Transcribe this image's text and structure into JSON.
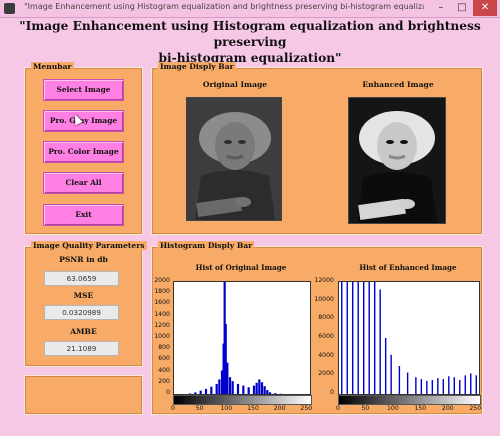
{
  "window": {
    "title": "\"Image Enhancement using Histogram equalization and brightness preserving bi-histogram equalization\"",
    "minimize": "–",
    "maximize": "□",
    "close": "✕",
    "icon": "matlab-figure-icon"
  },
  "header": {
    "line1": "\"Image Enhancement using Histogram equalization and brightness preserving",
    "line2": "bi-histogram equalization\""
  },
  "menubar": {
    "title": "Menubar",
    "buttons": [
      "Select Image",
      "Pro. Gray Image",
      "Pro. Color Image",
      "Clear All",
      "Exit"
    ]
  },
  "quality": {
    "title": "Image Quality Parameters",
    "psnr_label": "PSNR in db",
    "psnr_value": "63.0659",
    "mse_label": "MSE",
    "mse_value": "0.0320989",
    "ambe_label": "AMBE",
    "ambe_value": "21.1089"
  },
  "image_bar": {
    "title": "Image Disply Bar",
    "original_label": "Original Image",
    "enhanced_label": "Enhanced Image"
  },
  "hist_bar": {
    "title": "Histogram Disply Bar",
    "original_title": "Hist of Original Image",
    "enhanced_title": "Hist of Enhanced Image",
    "original_yticks": [
      "2000",
      "1800",
      "1600",
      "1400",
      "1200",
      "1000",
      "800",
      "600",
      "400",
      "200",
      "0"
    ],
    "enhanced_yticks": [
      "12000",
      "10000",
      "8000",
      "6000",
      "4000",
      "2000",
      "0"
    ],
    "xticks": [
      "0",
      "50",
      "100",
      "150",
      "200",
      "250"
    ]
  },
  "colors": {
    "background": "#f7c8e6",
    "panel": "#f8ab66",
    "button": "#ff7fe3",
    "histogram": "#0000cc"
  },
  "chart_data": [
    {
      "type": "bar",
      "title": "Hist of Original Image",
      "xlim": [
        0,
        255
      ],
      "ylim": [
        0,
        2000
      ],
      "x": [
        30,
        40,
        50,
        60,
        70,
        80,
        85,
        90,
        93,
        95,
        97,
        100,
        105,
        110,
        120,
        130,
        140,
        150,
        155,
        160,
        165,
        170,
        175,
        180,
        190,
        200
      ],
      "values": [
        10,
        30,
        60,
        90,
        130,
        180,
        260,
        420,
        900,
        2000,
        1250,
        560,
        300,
        230,
        180,
        150,
        120,
        150,
        200,
        260,
        210,
        140,
        70,
        30,
        15,
        5
      ]
    },
    {
      "type": "bar",
      "title": "Hist of Enhanced Image",
      "xlim": [
        0,
        255
      ],
      "ylim": [
        0,
        12000
      ],
      "x": [
        5,
        15,
        25,
        35,
        45,
        55,
        65,
        75,
        85,
        95,
        110,
        125,
        140,
        150,
        160,
        170,
        180,
        190,
        200,
        210,
        220,
        230,
        240,
        250
      ],
      "values": [
        12000,
        12000,
        12000,
        12000,
        12000,
        12000,
        12000,
        11200,
        6000,
        4200,
        3000,
        2300,
        1800,
        1600,
        1400,
        1500,
        1700,
        1600,
        1900,
        1800,
        1500,
        2000,
        2200,
        2000
      ]
    }
  ]
}
